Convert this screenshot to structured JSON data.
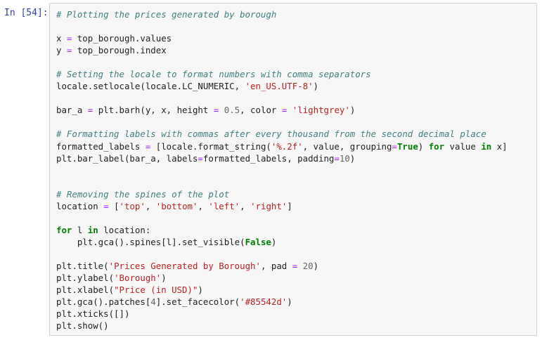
{
  "cell": {
    "prompt": "In [54]:",
    "lines": [
      [
        {
          "t": "# Plotting the prices generated by borough",
          "c": "c"
        }
      ],
      [],
      [
        {
          "t": "x "
        },
        {
          "t": "=",
          "c": "o"
        },
        {
          "t": " top_borough.values"
        }
      ],
      [
        {
          "t": "y "
        },
        {
          "t": "=",
          "c": "o"
        },
        {
          "t": " top_borough.index"
        }
      ],
      [],
      [
        {
          "t": "# Setting the locale to format numbers with comma separators",
          "c": "c"
        }
      ],
      [
        {
          "t": "locale.setlocale(locale.LC_NUMERIC, "
        },
        {
          "t": "'en_US.UTF-8'",
          "c": "s"
        },
        {
          "t": ")"
        }
      ],
      [],
      [
        {
          "t": "bar_a "
        },
        {
          "t": "=",
          "c": "o"
        },
        {
          "t": " plt.barh(y, x, height "
        },
        {
          "t": "=",
          "c": "o"
        },
        {
          "t": " "
        },
        {
          "t": "0.5",
          "c": "n"
        },
        {
          "t": ", color "
        },
        {
          "t": "=",
          "c": "o"
        },
        {
          "t": " "
        },
        {
          "t": "'lightgrey'",
          "c": "s"
        },
        {
          "t": ")"
        }
      ],
      [],
      [
        {
          "t": "# Formatting labels with commas after every thousand from the second decimal place",
          "c": "c"
        }
      ],
      [
        {
          "t": "formatted_labels "
        },
        {
          "t": "=",
          "c": "o"
        },
        {
          "t": " [locale.format_string("
        },
        {
          "t": "'%.2f'",
          "c": "s"
        },
        {
          "t": ", value, grouping"
        },
        {
          "t": "=",
          "c": "o"
        },
        {
          "t": "True",
          "c": "kc"
        },
        {
          "t": ") "
        },
        {
          "t": "for",
          "c": "k"
        },
        {
          "t": " value "
        },
        {
          "t": "in",
          "c": "k"
        },
        {
          "t": " x]"
        }
      ],
      [
        {
          "t": "plt.bar_label(bar_a, labels"
        },
        {
          "t": "=",
          "c": "o"
        },
        {
          "t": "formatted_labels, padding"
        },
        {
          "t": "=",
          "c": "o"
        },
        {
          "t": "10",
          "c": "n"
        },
        {
          "t": ")"
        }
      ],
      [],
      [],
      [
        {
          "t": "# Removing the spines of the plot",
          "c": "c"
        }
      ],
      [
        {
          "t": "location "
        },
        {
          "t": "=",
          "c": "o"
        },
        {
          "t": " ["
        },
        {
          "t": "'top'",
          "c": "s"
        },
        {
          "t": ", "
        },
        {
          "t": "'bottom'",
          "c": "s"
        },
        {
          "t": ", "
        },
        {
          "t": "'left'",
          "c": "s"
        },
        {
          "t": ", "
        },
        {
          "t": "'right'",
          "c": "s"
        },
        {
          "t": "]"
        }
      ],
      [],
      [
        {
          "t": "for",
          "c": "k"
        },
        {
          "t": " l "
        },
        {
          "t": "in",
          "c": "k"
        },
        {
          "t": " location:"
        }
      ],
      [
        {
          "t": "    plt.gca().spines[l].set_visible("
        },
        {
          "t": "False",
          "c": "kc"
        },
        {
          "t": ")"
        }
      ],
      [],
      [
        {
          "t": "plt.title("
        },
        {
          "t": "'Prices Generated by Borough'",
          "c": "s"
        },
        {
          "t": ", pad "
        },
        {
          "t": "=",
          "c": "o"
        },
        {
          "t": " "
        },
        {
          "t": "20",
          "c": "n"
        },
        {
          "t": ")"
        }
      ],
      [
        {
          "t": "plt.ylabel("
        },
        {
          "t": "'Borough'",
          "c": "s"
        },
        {
          "t": ")"
        }
      ],
      [
        {
          "t": "plt.xlabel("
        },
        {
          "t": "\"Price (in USD)\"",
          "c": "s"
        },
        {
          "t": ")"
        }
      ],
      [
        {
          "t": "plt.gca().patches["
        },
        {
          "t": "4",
          "c": "n"
        },
        {
          "t": "].set_facecolor("
        },
        {
          "t": "'#85542d'",
          "c": "s"
        },
        {
          "t": ")"
        }
      ],
      [
        {
          "t": "plt.xticks([])"
        }
      ],
      [
        {
          "t": "plt.show()"
        }
      ]
    ]
  },
  "colors": {
    "prompt": "#303f9f",
    "comment": "#408080",
    "string": "#ba2121",
    "number": "#666666",
    "operator": "#aa22ff",
    "keyword": "#008000"
  }
}
